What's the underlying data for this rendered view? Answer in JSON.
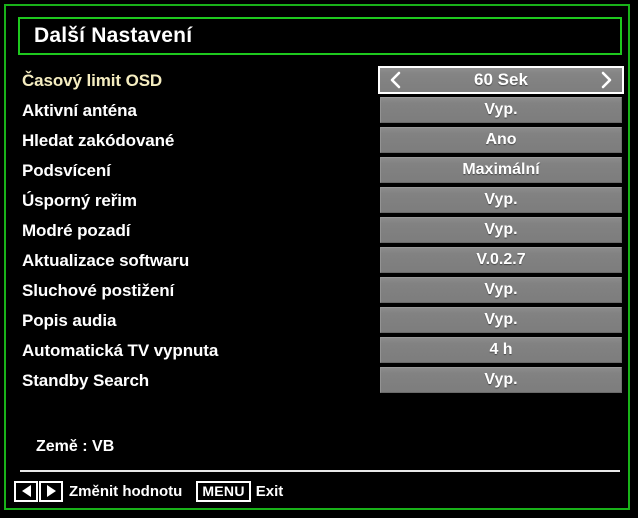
{
  "theme": {
    "background": "#000000",
    "frame_green": "#19b219",
    "title_border_green": "#1ec81e",
    "label_white": "#ffffff",
    "label_selected_yellow": "#f5edc0",
    "value_box_gray": "#828282",
    "highlight_border": "#ffffff"
  },
  "header": {
    "title": "Další Nastavení"
  },
  "settings": {
    "rows": [
      {
        "label": "Časový limit OSD",
        "value": "60 Sek",
        "selected": true
      },
      {
        "label": "Aktivní anténa",
        "value": "Vyp.",
        "selected": false
      },
      {
        "label": "Hledat zakódované",
        "value": "Ano",
        "selected": false
      },
      {
        "label": "Podsvícení",
        "value": "Maximální",
        "selected": false
      },
      {
        "label": "Úsporný reřim",
        "value": "Vyp.",
        "selected": false
      },
      {
        "label": "Modré pozadí",
        "value": "Vyp.",
        "selected": false
      },
      {
        "label": "Aktualizace softwaru",
        "value": "V.0.2.7",
        "selected": false
      },
      {
        "label": "Sluchové postižení",
        "value": "Vyp.",
        "selected": false
      },
      {
        "label": "Popis audia",
        "value": "Vyp.",
        "selected": false
      },
      {
        "label": "Automatická TV vypnuta",
        "value": "4 h",
        "selected": false
      },
      {
        "label": "Standby Search",
        "value": "Vyp.",
        "selected": false
      }
    ],
    "arrow_left_icon": "chevron-left-icon",
    "arrow_right_icon": "chevron-right-icon"
  },
  "status": {
    "country_line": "Země : VB"
  },
  "footer": {
    "left_key_icon": "arrow-left-icon",
    "right_key_icon": "arrow-right-icon",
    "change_value_hint": "Změnit hodnotu",
    "menu_key_label": "MENU",
    "exit_hint": "Exit"
  }
}
